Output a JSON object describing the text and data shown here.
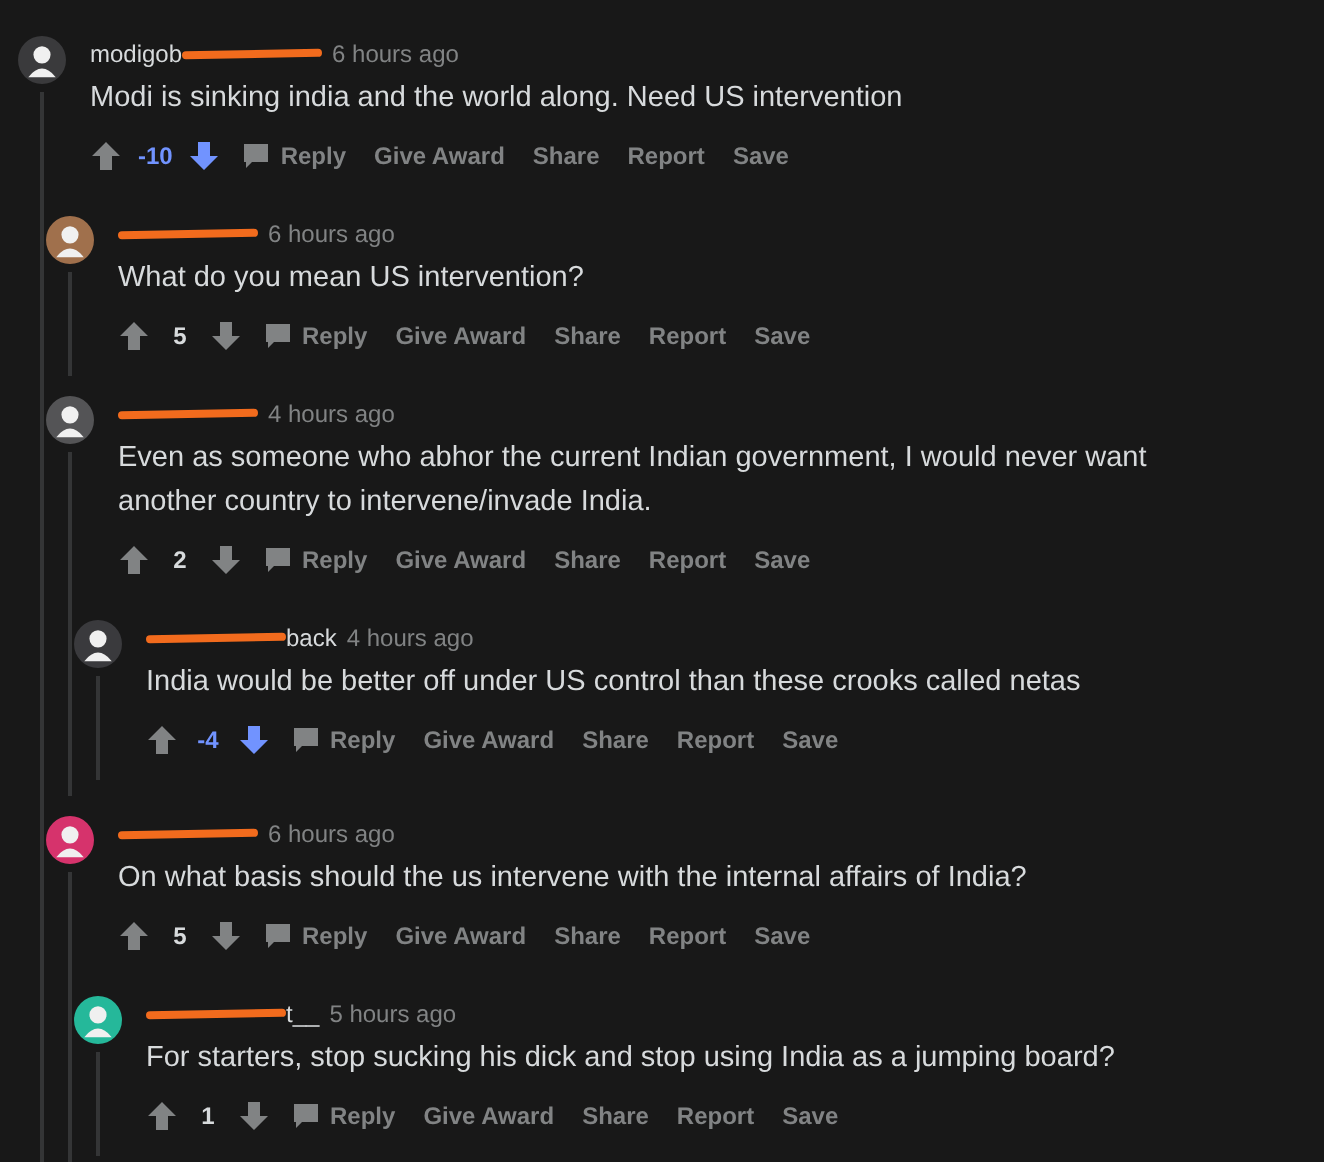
{
  "comments": [
    {
      "author": {
        "before": "modigob",
        "redacted": true
      },
      "color": "#3a3a3c",
      "time": "6 hours ago",
      "body": "Modi is sinking india and the world along. Need US intervention",
      "score": "-10",
      "downvoted": true,
      "actions": [
        "Reply",
        "Give Award",
        "Share",
        "Report",
        "Save"
      ],
      "children": [
        {
          "author": {
            "redacted": true
          },
          "color": "#a0704c",
          "time": "6 hours ago",
          "body": "What do you mean US intervention?",
          "score": "5",
          "downvoted": false,
          "actions": [
            "Reply",
            "Give Award",
            "Share",
            "Report",
            "Save"
          ]
        },
        {
          "author": {
            "redacted": true
          },
          "color": "#545456",
          "time": "4 hours ago",
          "body": "Even as someone who abhor the current Indian government, I would never want another country to intervene/invade India.",
          "score": "2",
          "downvoted": false,
          "actions": [
            "Reply",
            "Give Award",
            "Share",
            "Report",
            "Save"
          ],
          "children": [
            {
              "author": {
                "after": "back",
                "redacted": true
              },
              "color": "#3a3a3d",
              "time": "4 hours ago",
              "body": "India would be better off under US control than these crooks called netas",
              "score": "-4",
              "downvoted": true,
              "actions": [
                "Reply",
                "Give Award",
                "Share",
                "Report",
                "Save"
              ]
            }
          ]
        },
        {
          "author": {
            "redacted": true
          },
          "color": "#d6336c",
          "time": "6 hours ago",
          "body": "On what basis should the us intervene with the internal affairs of India?",
          "score": "5",
          "downvoted": false,
          "actions": [
            "Reply",
            "Give Award",
            "Share",
            "Report",
            "Save"
          ],
          "children": [
            {
              "author": {
                "after": "t__",
                "redacted": true
              },
              "color": "#25b89a",
              "time": "5 hours ago",
              "body": "For starters, stop sucking his dick and stop using India as a jumping board?",
              "score": "1",
              "downvoted": false,
              "actions": [
                "Reply",
                "Give Award",
                "Share",
                "Report",
                "Save"
              ]
            }
          ]
        }
      ]
    }
  ]
}
